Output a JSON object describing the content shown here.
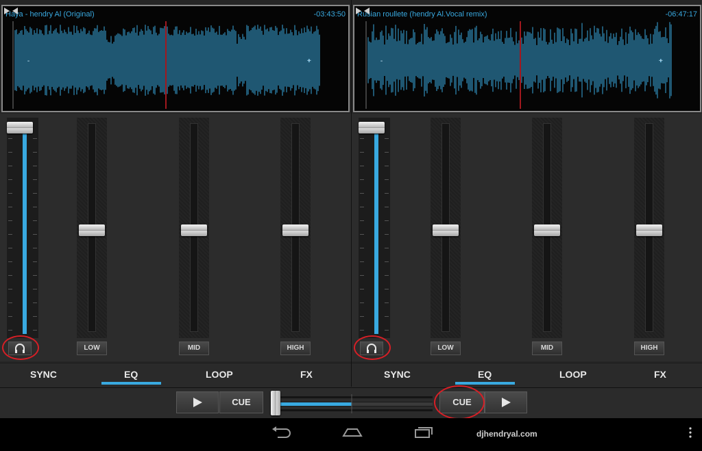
{
  "deck_a": {
    "title": "Haya - hendry Al (Original)",
    "time": "-03:43:50",
    "eq_labels": [
      "LOW",
      "MID",
      "HIGH"
    ],
    "tabs": [
      "SYNC",
      "EQ",
      "LOOP",
      "FX"
    ],
    "active_tab": "EQ",
    "volume_level": 1.0,
    "eq_levels": [
      0.5,
      0.5,
      0.5
    ]
  },
  "deck_b": {
    "title": "Rusian roullete (hendry Al.Vocal remix)",
    "time": "-06:47:17",
    "eq_labels": [
      "LOW",
      "MID",
      "HIGH"
    ],
    "tabs": [
      "SYNC",
      "EQ",
      "LOOP",
      "FX"
    ],
    "active_tab": "EQ",
    "volume_level": 1.0,
    "eq_levels": [
      0.5,
      0.5,
      0.5
    ]
  },
  "transport": {
    "cue_left": "CUE",
    "cue_right": "CUE",
    "crossfader_position": 0.0
  },
  "navbar": {
    "brand": "djhendryal.com"
  },
  "colors": {
    "accent": "#39a9e0",
    "playhead": "#d71f26",
    "annotation": "#d71f26"
  },
  "icons": [
    "play-icon",
    "headphones-icon",
    "back-icon",
    "home-icon",
    "recent-apps-icon",
    "overflow-menu-icon",
    "waveform-end-icon"
  ]
}
